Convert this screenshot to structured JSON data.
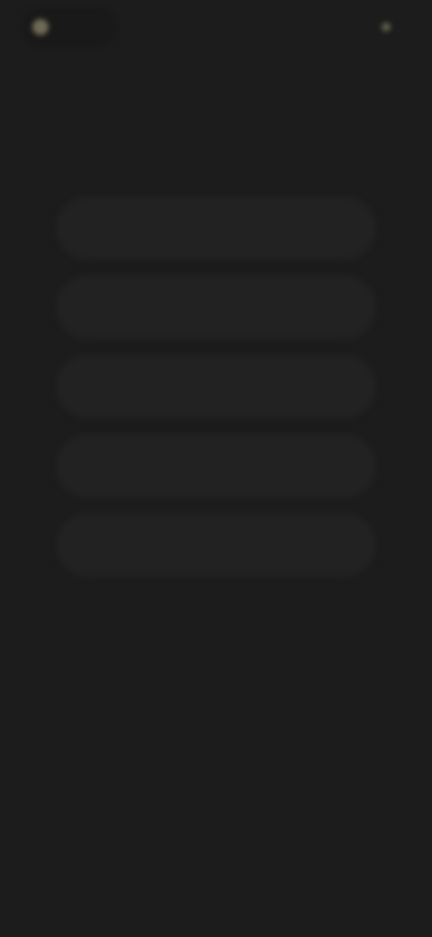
{
  "header": {
    "brand_name": "",
    "action_label": ""
  },
  "question": {
    "text": ""
  },
  "options": [
    {
      "label": ""
    },
    {
      "label": ""
    },
    {
      "label": ""
    },
    {
      "label": ""
    },
    {
      "label": ""
    }
  ],
  "colors": {
    "background": "#1c1c1c",
    "option_background": "#222222",
    "brand_accent": "#8a8568"
  }
}
